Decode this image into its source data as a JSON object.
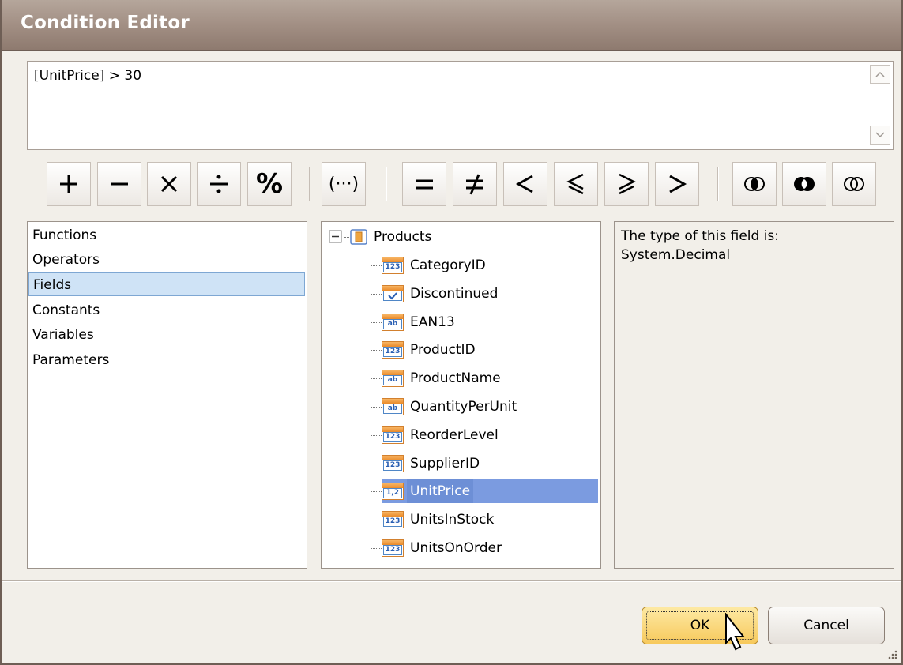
{
  "window": {
    "title": "Condition Editor"
  },
  "expression": {
    "text": "[UnitPrice] > 30"
  },
  "toolbar": {
    "operators": [
      {
        "symbol": "+",
        "name": "plus"
      },
      {
        "symbol": "—",
        "name": "minus"
      },
      {
        "symbol": "×",
        "name": "multiply"
      },
      {
        "symbol": "÷",
        "name": "divide"
      },
      {
        "symbol": "%",
        "name": "modulo"
      },
      {
        "symbol": "(···)",
        "name": "parentheses"
      },
      {
        "symbol": "=",
        "name": "equal"
      },
      {
        "symbol": "≠",
        "name": "not-equal"
      },
      {
        "symbol": "<",
        "name": "less"
      },
      {
        "symbol": "≤",
        "name": "less-or-equal"
      },
      {
        "symbol": "≥",
        "name": "greater-or-equal"
      },
      {
        "symbol": ">",
        "name": "greater"
      },
      {
        "symbol": "and-icon",
        "name": "and"
      },
      {
        "symbol": "or-icon",
        "name": "or"
      },
      {
        "symbol": "not-icon",
        "name": "not"
      }
    ]
  },
  "categories": {
    "items": [
      "Functions",
      "Operators",
      "Fields",
      "Constants",
      "Variables",
      "Parameters"
    ],
    "selected": "Fields"
  },
  "tree": {
    "root": "Products",
    "fields": [
      {
        "name": "CategoryID",
        "type": "123"
      },
      {
        "name": "Discontinued",
        "type": "check"
      },
      {
        "name": "EAN13",
        "type": "ab"
      },
      {
        "name": "ProductID",
        "type": "123"
      },
      {
        "name": "ProductName",
        "type": "ab"
      },
      {
        "name": "QuantityPerUnit",
        "type": "ab"
      },
      {
        "name": "ReorderLevel",
        "type": "123"
      },
      {
        "name": "SupplierID",
        "type": "123"
      },
      {
        "name": "UnitPrice",
        "type": "1,2"
      },
      {
        "name": "UnitsInStock",
        "type": "123"
      },
      {
        "name": "UnitsOnOrder",
        "type": "123"
      }
    ],
    "selected": "UnitPrice"
  },
  "description": {
    "line1": "The type of this field is:",
    "line2": "System.Decimal"
  },
  "buttons": {
    "ok": "OK",
    "cancel": "Cancel"
  },
  "colors": {
    "selection": "#7b9be0",
    "title_bar": "#a28f84",
    "default_button": "#f7c95c"
  }
}
